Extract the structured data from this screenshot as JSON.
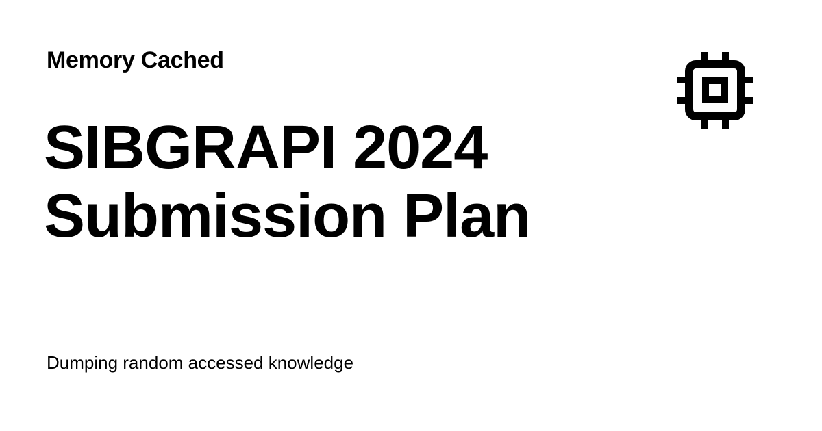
{
  "site": {
    "name": "Memory Cached",
    "tagline": "Dumping random accessed knowledge",
    "logo_icon": "cpu-chip-icon"
  },
  "post": {
    "title_lines": [
      "SIBGRAPI 2024",
      "Submission Plan"
    ]
  },
  "colors": {
    "background": "#ffffff",
    "text": "#000000"
  }
}
